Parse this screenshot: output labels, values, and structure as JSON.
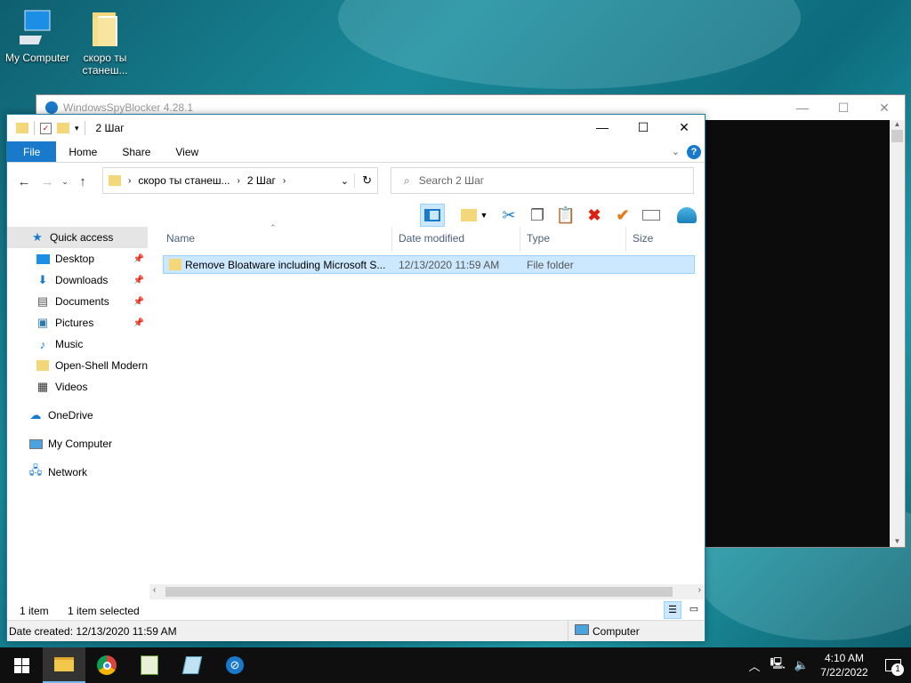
{
  "desktop": {
    "icons": [
      {
        "label": "My Computer",
        "icon": "computer-icon"
      },
      {
        "label": "скоро ты станеш...",
        "icon": "folder-icon"
      }
    ]
  },
  "spy_window": {
    "title": "WindowsSpyBlocker 4.28.1"
  },
  "explorer": {
    "title": "2 Шаг",
    "ribbon_tabs": {
      "file": "File",
      "home": "Home",
      "share": "Share",
      "view": "View"
    },
    "address": {
      "part1": "скоро ты станеш...",
      "part2": "2 Шаг"
    },
    "search": {
      "placeholder": "Search 2 Шаг"
    },
    "nav": {
      "quick_access": "Quick access",
      "desktop": "Desktop",
      "downloads": "Downloads",
      "documents": "Documents",
      "pictures": "Pictures",
      "music": "Music",
      "openshell": "Open-Shell Modern",
      "videos": "Videos",
      "onedrive": "OneDrive",
      "mycomputer": "My Computer",
      "network": "Network"
    },
    "columns": {
      "name": "Name",
      "date": "Date modified",
      "type": "Type",
      "size": "Size"
    },
    "files": [
      {
        "name": "Remove Bloatware including Microsoft S...",
        "date": "12/13/2020 11:59 AM",
        "type": "File folder",
        "size": ""
      }
    ],
    "status": {
      "count": "1 item",
      "selected": "1 item selected"
    },
    "details": {
      "created": "Date created: 12/13/2020 11:59 AM",
      "location": "Computer"
    }
  },
  "taskbar": {
    "time": "4:10 AM",
    "date": "7/22/2022",
    "notifications": "1",
    "accent": "#76b9ed"
  }
}
